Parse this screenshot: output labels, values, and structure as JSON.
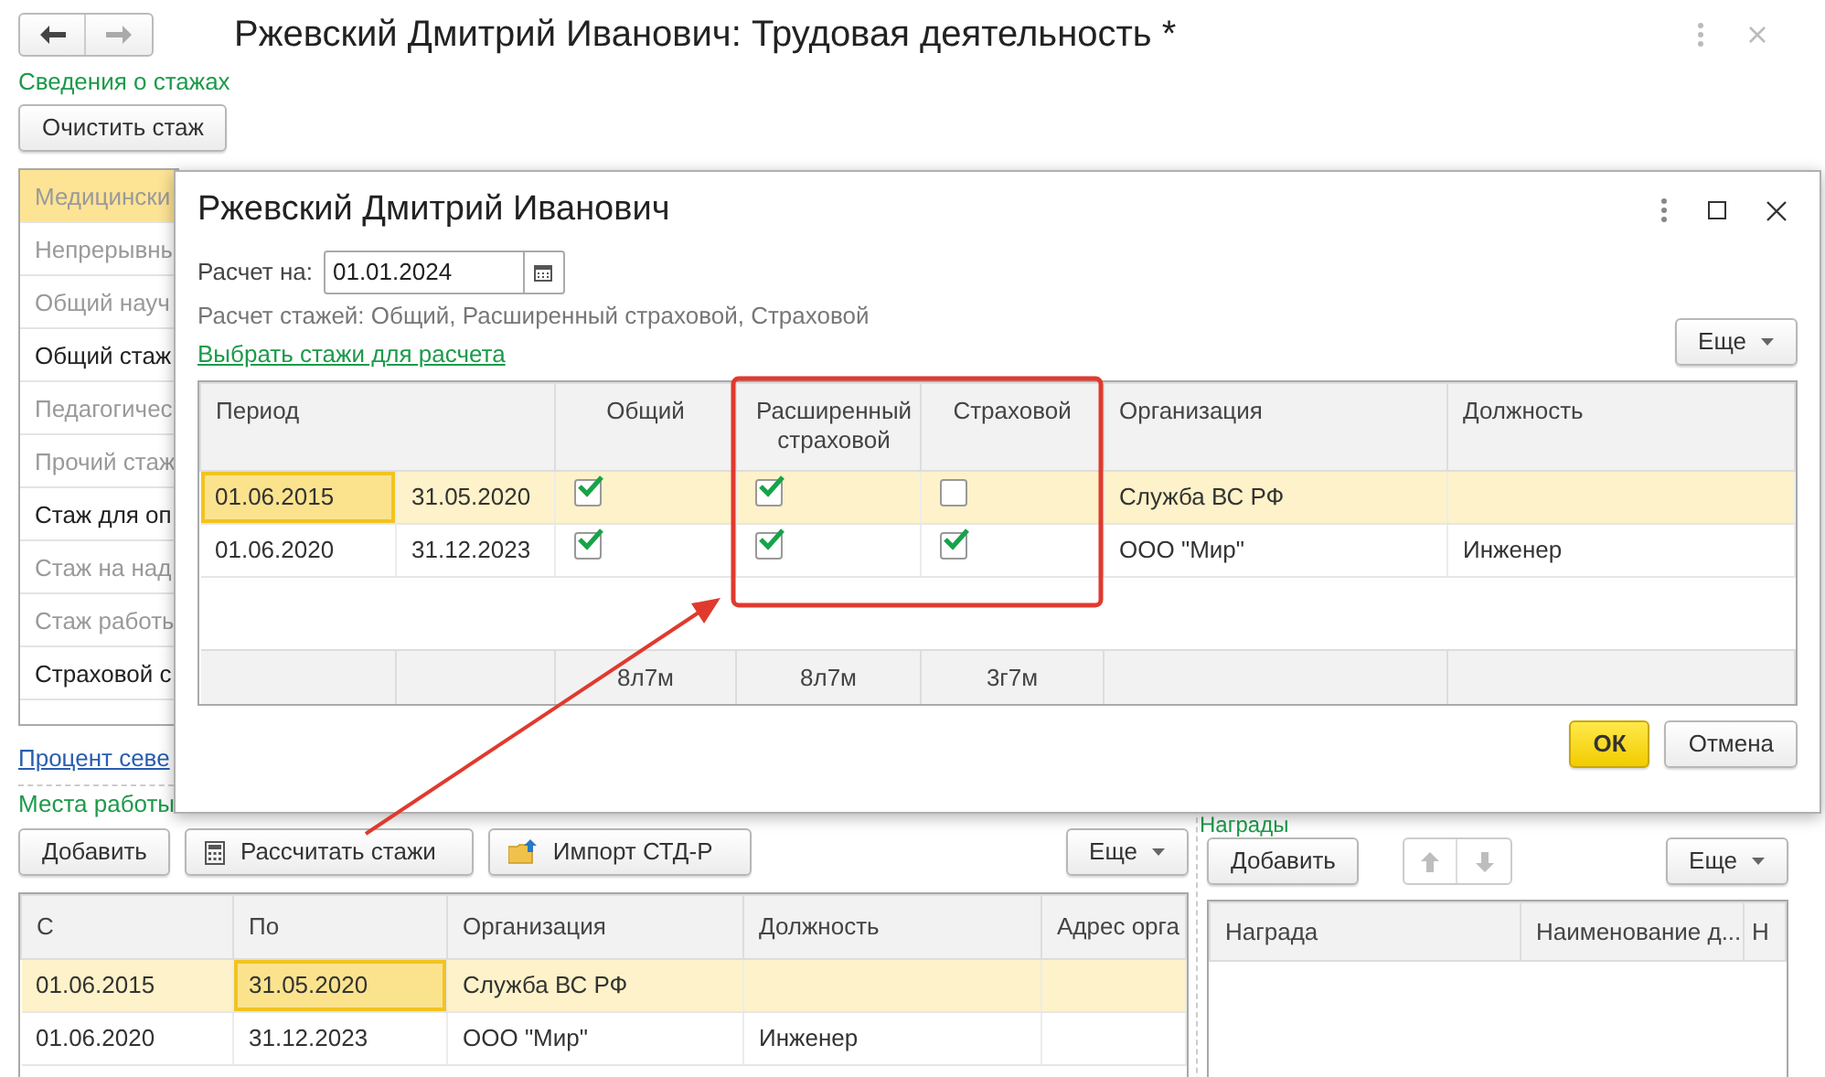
{
  "window": {
    "title": "Ржевский Дмитрий Иванович: Трудовая деятельность *"
  },
  "experience": {
    "title": "Сведения о стажах",
    "clear_button": "Очистить стаж",
    "items": [
      {
        "label": "Медицински",
        "selected": true,
        "disabled": true
      },
      {
        "label": "Непрерывны",
        "selected": false,
        "disabled": true
      },
      {
        "label": "Общий науч",
        "selected": false,
        "disabled": true
      },
      {
        "label": "Общий стаж",
        "selected": false,
        "disabled": false
      },
      {
        "label": "Педагогичес",
        "selected": false,
        "disabled": true
      },
      {
        "label": "Прочий стаж",
        "selected": false,
        "disabled": true
      },
      {
        "label": "Стаж для оп",
        "selected": false,
        "disabled": false
      },
      {
        "label": "Стаж на над",
        "selected": false,
        "disabled": true
      },
      {
        "label": "Стаж работы",
        "selected": false,
        "disabled": true
      },
      {
        "label": "Страховой с",
        "selected": false,
        "disabled": false
      }
    ],
    "link": "Процент севе"
  },
  "workplaces": {
    "title": "Места работы",
    "buttons": [
      {
        "label": "Добавить",
        "kind": "plain"
      },
      {
        "label": "Рассчитать стажи",
        "kind": "calculator"
      },
      {
        "label": "Импорт СТД-Р",
        "kind": "folder"
      }
    ],
    "more": "Еще",
    "columns": [
      "С",
      "По",
      "Организация",
      "Должность",
      "Адрес орга"
    ],
    "rows": [
      {
        "selected": true,
        "cells": [
          {
            "text": "01.06.2015",
            "focused": false
          },
          {
            "text": "31.05.2020",
            "focused": true
          },
          {
            "text": "Служба ВС РФ",
            "focused": false
          },
          {
            "text": "",
            "focused": false
          },
          {
            "text": "",
            "focused": false
          }
        ]
      },
      {
        "selected": false,
        "cells": [
          {
            "text": "01.06.2020",
            "focused": false
          },
          {
            "text": "31.12.2023",
            "focused": false
          },
          {
            "text": "ООО \"Мир\"",
            "focused": false
          },
          {
            "text": "Инженер",
            "focused": false
          },
          {
            "text": "",
            "focused": false
          }
        ]
      }
    ]
  },
  "awards": {
    "title": "Награды",
    "add": "Добавить",
    "arrows_disabled": true,
    "more": "Еще",
    "columns": [
      "Награда",
      "Наименование д...",
      "Н"
    ]
  },
  "dialog": {
    "title": "Ржевский Дмитрий Иванович",
    "date_label": "Расчет на:",
    "date_value": "01.01.2024",
    "info": "Расчет стажей: Общий, Расширенный страховой, Страховой",
    "link": "Выбрать стажи для расчета",
    "more": "Еще",
    "columns": [
      "Период",
      "Общий",
      "Расширенный страховой",
      "Страховой",
      "Организация",
      "Должность"
    ],
    "rows": [
      {
        "selected": true,
        "from": "01.06.2015",
        "from_focused": true,
        "to": "31.05.2020",
        "flags": [
          {
            "checked": true
          },
          {
            "checked": true
          },
          {
            "checked": false
          }
        ],
        "organization": "Служба ВС РФ",
        "position": ""
      },
      {
        "selected": false,
        "from": "01.06.2020",
        "from_focused": false,
        "to": "31.12.2023",
        "flags": [
          {
            "checked": true
          },
          {
            "checked": true
          },
          {
            "checked": true
          }
        ],
        "organization": "ООО \"Мир\"",
        "position": "Инженер"
      }
    ],
    "totals": [
      "8л7м",
      "8л7м",
      "3г7м"
    ],
    "ok": "ОК",
    "cancel": "Отмена"
  }
}
